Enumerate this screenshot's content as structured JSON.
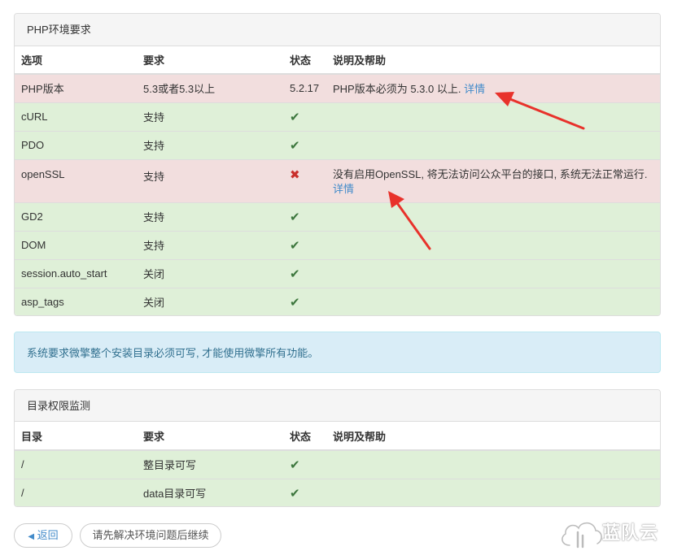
{
  "env_panel": {
    "title": "PHP环境要求",
    "headers": [
      "选项",
      "要求",
      "状态",
      "说明及帮助"
    ],
    "rows": [
      {
        "option": "PHP版本",
        "req": "5.3或者5.3以上",
        "status_text": "5.2.17",
        "help": "PHP版本必须为 5.3.0 以上.",
        "help_link": "详情"
      },
      {
        "option": "cURL",
        "req": "支持",
        "status_icon": "✔"
      },
      {
        "option": "PDO",
        "req": "支持",
        "status_icon": "✔"
      },
      {
        "option": "openSSL",
        "req": "支持",
        "status_icon": "✖",
        "help": "没有启用OpenSSL, 将无法访问公众平台的接口, 系统无法正常运行.",
        "help_link": "详情"
      },
      {
        "option": "GD2",
        "req": "支持",
        "status_icon": "✔"
      },
      {
        "option": "DOM",
        "req": "支持",
        "status_icon": "✔"
      },
      {
        "option": "session.auto_start",
        "req": "关闭",
        "status_icon": "✔"
      },
      {
        "option": "asp_tags",
        "req": "关闭",
        "status_icon": "✔"
      }
    ]
  },
  "alert": {
    "text": "系统要求微擎整个安装目录必须可写, 才能使用微擎所有功能。"
  },
  "dir_panel": {
    "title": "目录权限监测",
    "headers": [
      "目录",
      "要求",
      "状态",
      "说明及帮助"
    ],
    "rows": [
      {
        "dir": "/",
        "req": "整目录可写",
        "status_icon": "✔"
      },
      {
        "dir": "/",
        "req": "data目录可写",
        "status_icon": "✔"
      }
    ]
  },
  "buttons": {
    "back_icon": "◀",
    "back_label": "返回",
    "continue_label": "请先解决环境问题后继续"
  },
  "watermark": {
    "text": "蓝队云"
  },
  "colors": {
    "ok_row": "#dff0d8",
    "bad_row": "#f2dede",
    "check": "#3c763d",
    "cross": "#c9302c",
    "link": "#428bca",
    "arrow": "#e8322b"
  },
  "icons": [
    "check-icon",
    "cross-icon",
    "chevron-left-icon",
    "cloud-logo-icon"
  ]
}
